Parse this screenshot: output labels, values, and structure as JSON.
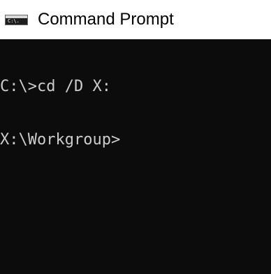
{
  "window": {
    "title": "Command Prompt",
    "icon": "cmd-console-icon",
    "icon_text": "C:\\."
  },
  "console": {
    "background": "#0c0c0c",
    "text_color": "#cccccc",
    "lines": [
      "C:\\>cd /D X:",
      "X:\\Workgroup>"
    ]
  }
}
